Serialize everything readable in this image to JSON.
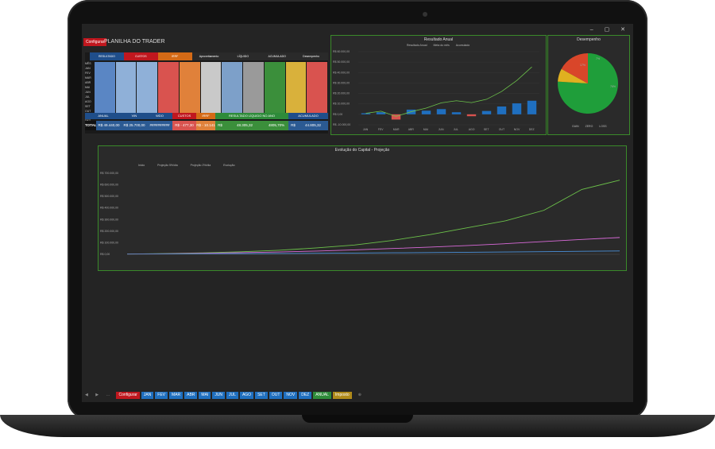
{
  "app": {
    "config_label": "Configurar",
    "title": "PLANILHA DO TRADER",
    "window_controls": "– ▢ ✕"
  },
  "table": {
    "group_headers": [
      "RESULTADO",
      "CUSTOS",
      "IRRF",
      "Aproveitamento",
      "LÍQUIDO",
      "ACUMULADO",
      "Desempenho"
    ],
    "col_headers": [
      "TOTAL MÊS",
      "VIN",
      "WDO",
      "GAIN",
      "Zero",
      "LOSS",
      "Mensal"
    ],
    "month_header": "MÊS",
    "months": [
      "JAN",
      "FEV",
      "MAR",
      "ABR",
      "MAI",
      "JUN",
      "JUL",
      "AGO",
      "SET",
      "OUT",
      "NOV",
      "DEZ"
    ]
  },
  "summary": {
    "headers": [
      "ANUAL",
      "VIN",
      "WDO",
      "CUSTOS",
      "IRRF",
      "RESULTADO LÍQUIDO NO ANO",
      "ACUMULADO"
    ],
    "total_label": "TOTAL",
    "values": [
      "R$ 49.440,00",
      "R$ 25.700,00",
      "##########",
      "R$ - 477,30",
      "R$ - 10.141",
      "R$",
      "48.305,32",
      "4805,70%",
      "R$",
      "44.805,32"
    ]
  },
  "chart_annual": {
    "title": "Resultado Anual",
    "legend": [
      "Resultado Anual",
      "Meta do mês",
      "Acumulado"
    ],
    "y_ticks": [
      "R$ 60.000,00",
      "R$ 50.000,00",
      "R$ 40.000,00",
      "R$ 30.000,00",
      "R$ 20.000,00",
      "R$ 10.000,00",
      "R$ 0,00",
      "R$ -10.000,00"
    ],
    "x_ticks": [
      "JAN",
      "FEV",
      "MAR",
      "ABR",
      "MAI",
      "JUN",
      "JUL",
      "AGO",
      "SET",
      "OUT",
      "NOV",
      "DEZ"
    ]
  },
  "chart_perf": {
    "title": "Desempenho",
    "legend": [
      "GAIN",
      "ZERO",
      "LOSS"
    ],
    "labels": [
      "76%",
      "17%",
      "7%"
    ]
  },
  "chart_capital": {
    "title": "Evolução do Capital - Projeção",
    "legend": [
      "Inicio",
      "Projeção 5%/dia",
      "Projeção 2%/dia",
      "Evolução"
    ],
    "y_ticks": [
      "R$ 700.000,00",
      "R$ 600.000,00",
      "R$ 500.000,00",
      "R$ 400.000,00",
      "R$ 300.000,00",
      "R$ 200.000,00",
      "R$ 100.000,00",
      "R$ 0,00"
    ]
  },
  "chart_data": [
    {
      "type": "bar",
      "title": "Resultado Anual",
      "categories": [
        "JAN",
        "FEV",
        "MAR",
        "ABR",
        "MAI",
        "JUN",
        "JUL",
        "AGO",
        "SET",
        "OUT",
        "NOV",
        "DEZ"
      ],
      "series": [
        {
          "name": "Resultado Anual",
          "values": [
            1000,
            2000,
            -5000,
            4500,
            3500,
            5000,
            2000,
            -1800,
            3200,
            7500,
            10500,
            13000
          ]
        },
        {
          "name": "Acumulado",
          "values": [
            1000,
            3000,
            -2000,
            2500,
            6000,
            11000,
            13000,
            11200,
            14400,
            21900,
            32400,
            45400
          ]
        }
      ],
      "ylim": [
        -10000,
        60000
      ]
    },
    {
      "type": "pie",
      "title": "Desempenho",
      "categories": [
        "GAIN",
        "ZERO",
        "LOSS"
      ],
      "values": [
        76,
        7,
        17
      ]
    },
    {
      "type": "line",
      "title": "Evolução do Capital - Projeção",
      "series": [
        {
          "name": "Evolução",
          "values": [
            2000,
            6000,
            12000,
            22000,
            35000,
            55000,
            80000,
            120000,
            170000,
            230000,
            290000,
            380000,
            560000,
            640000
          ]
        },
        {
          "name": "Projeção 5%/dia",
          "values": [
            2000,
            5000,
            9000,
            14000,
            20000,
            28000,
            38000,
            50000,
            62000,
            76000,
            92000,
            110000,
            128000,
            145000
          ]
        },
        {
          "name": "Projeção 2%/dia",
          "values": [
            2000,
            3000,
            4500,
            6000,
            7500,
            9000,
            11000,
            13000,
            15000,
            17500,
            20000,
            23000,
            26000,
            29000
          ]
        }
      ],
      "ylim": [
        0,
        700000
      ]
    }
  ],
  "tabs": [
    {
      "label": "Configurar",
      "color": "#c0171e"
    },
    {
      "label": "JAN",
      "color": "#1f6fbf"
    },
    {
      "label": "FEV",
      "color": "#1f6fbf"
    },
    {
      "label": "MAR",
      "color": "#1f6fbf"
    },
    {
      "label": "ABR",
      "color": "#1f6fbf"
    },
    {
      "label": "MAI",
      "color": "#1f6fbf"
    },
    {
      "label": "JUN",
      "color": "#1f6fbf"
    },
    {
      "label": "JUL",
      "color": "#1f6fbf"
    },
    {
      "label": "AGO",
      "color": "#1f6fbf"
    },
    {
      "label": "SET",
      "color": "#1f6fbf"
    },
    {
      "label": "OUT",
      "color": "#1f6fbf"
    },
    {
      "label": "NOV",
      "color": "#1f6fbf"
    },
    {
      "label": "DEZ",
      "color": "#1f6fbf"
    },
    {
      "label": "ANUAL",
      "color": "#2e8b3a"
    },
    {
      "label": "Imposto",
      "color": "#b08a1a"
    }
  ]
}
